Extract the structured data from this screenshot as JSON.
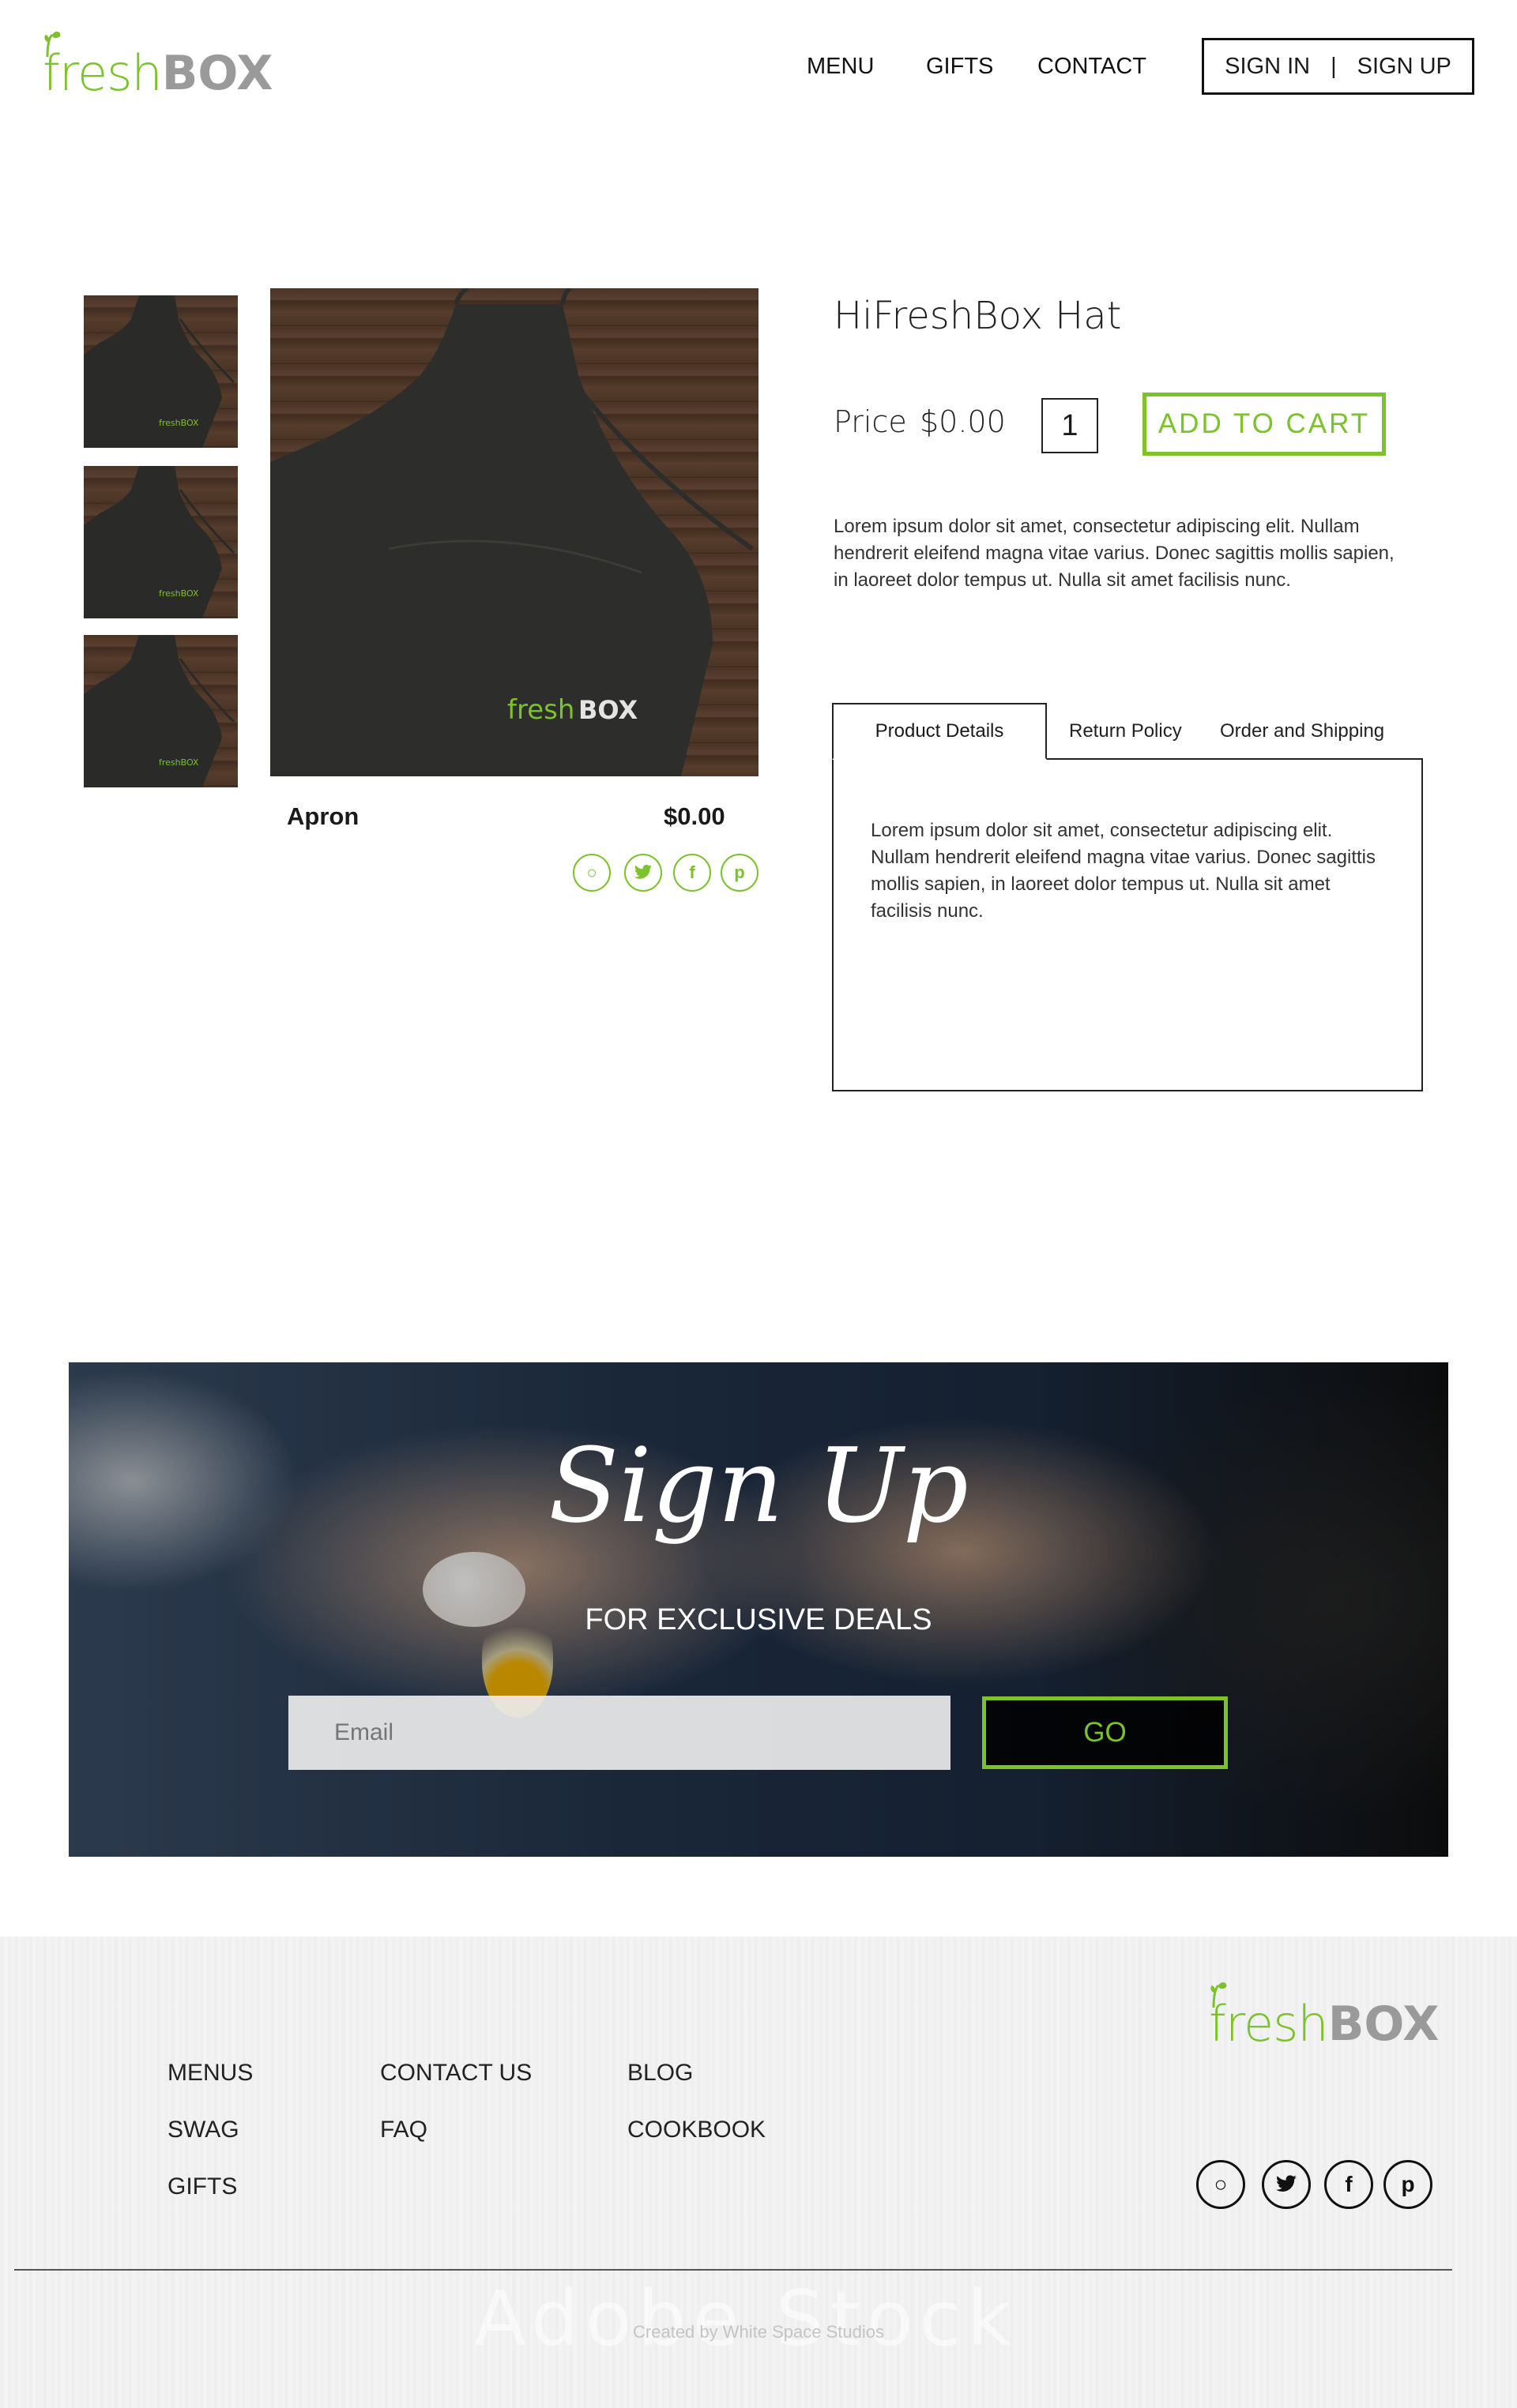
{
  "brand": {
    "fresh": "fresh",
    "box": "BOX"
  },
  "nav": {
    "menu": "MENU",
    "gifts": "GIFTS",
    "contact": "CONTACT"
  },
  "auth": {
    "sign_in": "SIGN IN",
    "divider": "|",
    "sign_up": "SIGN UP"
  },
  "gallery": {
    "caption_name": "Apron",
    "caption_price": "$0.00"
  },
  "product": {
    "title": "HiFreshBox Hat",
    "price_label": "Price",
    "price_value": "$0.00",
    "quantity": "1",
    "add_to_cart": "ADD TO CART",
    "description": "Lorem ipsum dolor sit amet, consectetur adipiscing elit. Nullam hendrerit eleifend magna vitae varius. Donec sagittis mollis sapien, in laoreet dolor tempus ut. Nulla sit amet facilisis nunc."
  },
  "tabs": {
    "items": [
      "Product Details",
      "Return Policy",
      "Order and Shipping"
    ],
    "active": "Product Details",
    "content": "Lorem ipsum dolor sit amet, consectetur adipiscing elit. Nullam hendrerit eleifend magna vitae varius. Donec sagittis mollis sapien, in laoreet dolor tempus ut. Nulla sit amet facilisis nunc."
  },
  "signup": {
    "title": "Sign Up",
    "subtitle": "FOR EXCLUSIVE DEALS",
    "email_placeholder": "Email",
    "go": "GO"
  },
  "footer": {
    "col1": [
      "MENUS",
      "SWAG",
      "GIFTS"
    ],
    "col2": [
      "CONTACT US",
      "FAQ"
    ],
    "col3": [
      "BLOG",
      "COOKBOOK"
    ],
    "credit": "Created by White Space Studios",
    "watermark": "Adobe Stock"
  },
  "social": {
    "icons": [
      "instagram-icon",
      "twitter-icon",
      "facebook-icon",
      "pinterest-icon"
    ]
  },
  "colors": {
    "accent": "#7cc22a",
    "text": "#1a1a1a",
    "logo_gray": "#9a9a9a"
  }
}
